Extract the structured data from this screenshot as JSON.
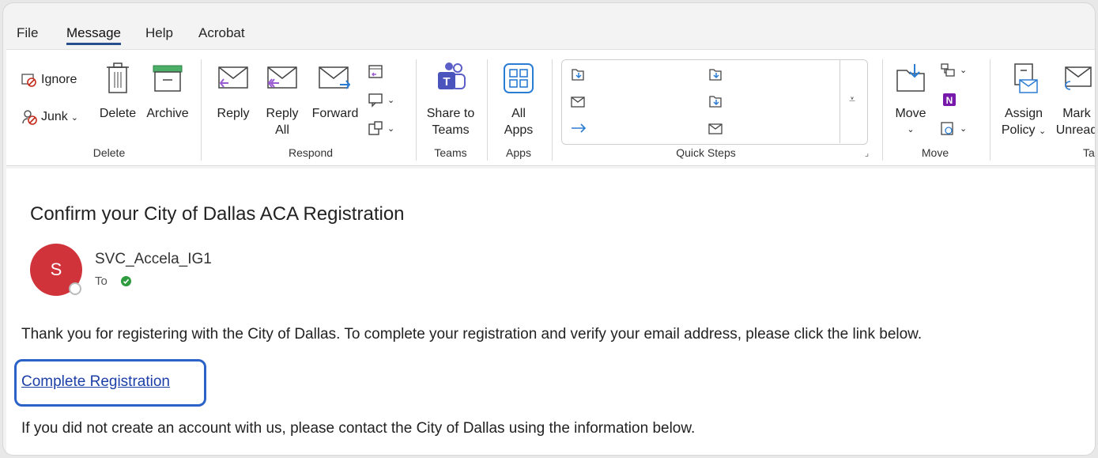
{
  "menu": {
    "tabs": [
      "File",
      "Message",
      "Help",
      "Acrobat"
    ],
    "active": "Message"
  },
  "ribbon": {
    "delete_group": {
      "ignore": "Ignore",
      "junk": "Junk",
      "delete": "Delete",
      "archive": "Archive",
      "label": "Delete"
    },
    "respond_group": {
      "reply": "Reply",
      "reply_all_1": "Reply",
      "reply_all_2": "All",
      "forward": "Forward",
      "label": "Respond"
    },
    "teams_group": {
      "share_1": "Share to",
      "share_2": "Teams",
      "label": "Teams"
    },
    "apps_group": {
      "all_1": "All",
      "all_2": "Apps",
      "label": "Apps"
    },
    "quick_steps": {
      "label": "Quick Steps"
    },
    "move_group": {
      "move": "Move",
      "label": "Move"
    },
    "tags_group": {
      "assign_1": "Assign",
      "assign_2": "Policy",
      "mark_1": "Mark",
      "mark_2": "Unread",
      "label": "Ta"
    }
  },
  "message": {
    "subject": "Confirm your City of Dallas ACA Registration",
    "avatar_initial": "S",
    "sender": "SVC_Accela_IG1",
    "to_label": "To",
    "body_line1": "Thank you for registering with the City of Dallas. To complete your registration and verify your email address, please click the link below.",
    "link_text": "Complete Registration",
    "body_line2": "If you did not create an account with us, please contact the City of Dallas using the information below."
  },
  "colors": {
    "accent": "#2b62c8",
    "avatar": "#d0333a",
    "teams": "#5b5fc7",
    "apps": "#2b7cd3"
  }
}
